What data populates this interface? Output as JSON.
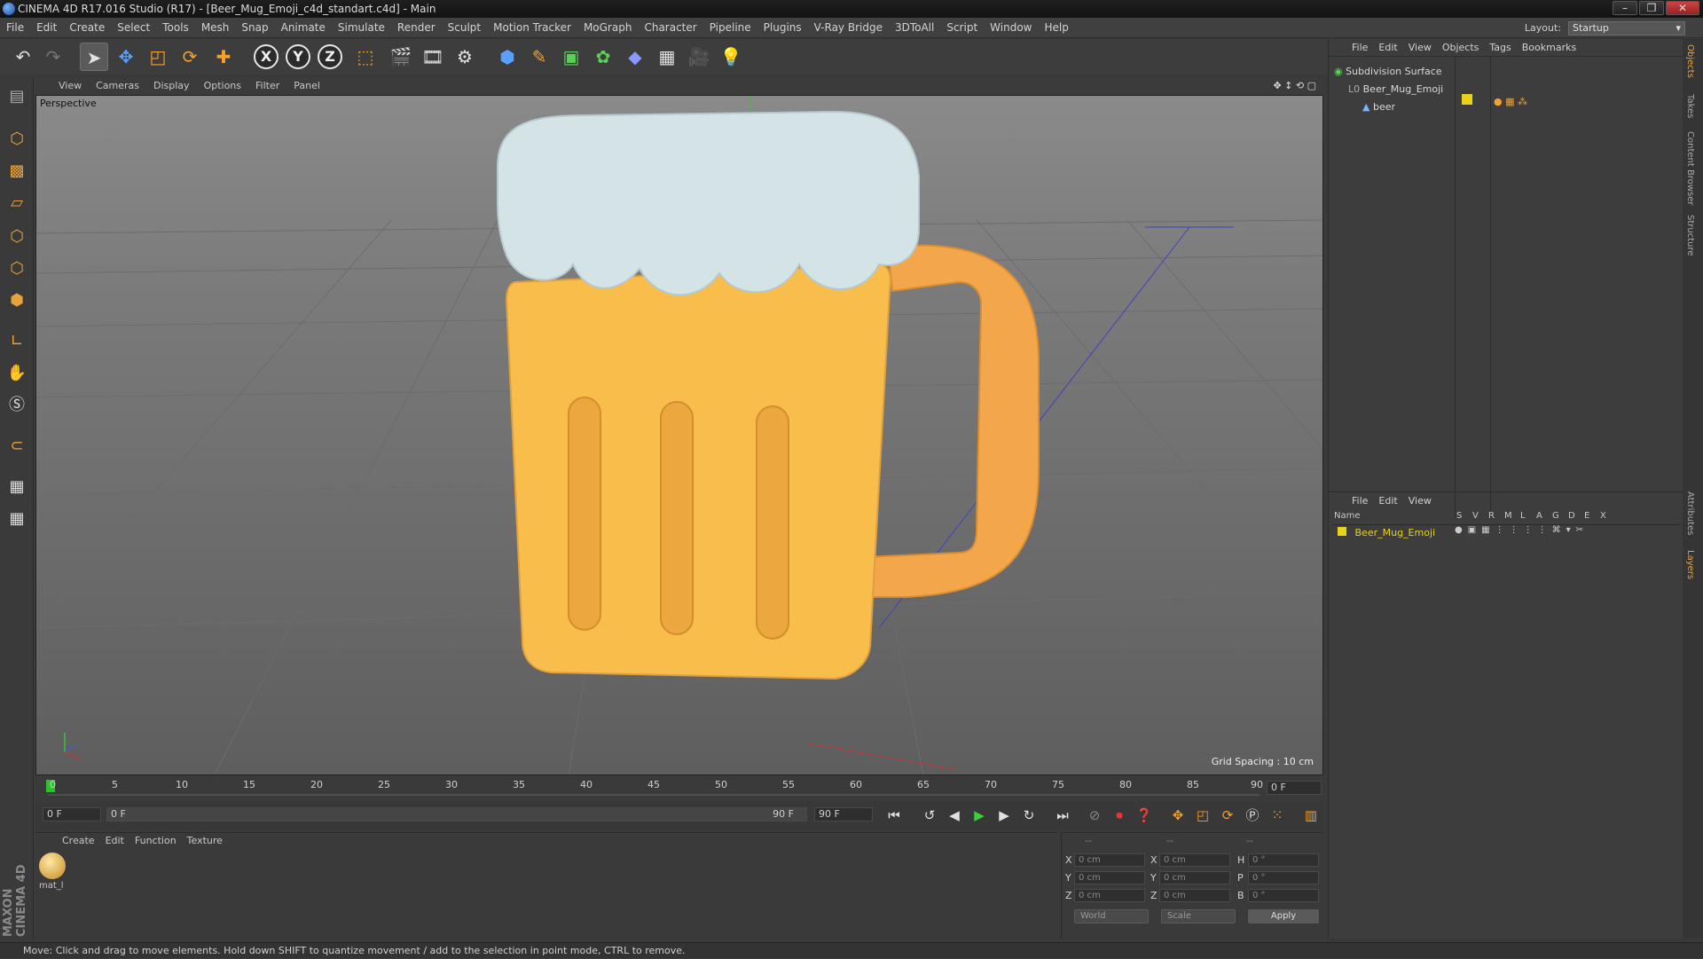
{
  "window": {
    "title": "CINEMA 4D R17.016 Studio (R17) - [Beer_Mug_Emoji_c4d_standart.c4d] - Main",
    "controls": [
      "–",
      "❐",
      "✕"
    ]
  },
  "menubar": [
    "File",
    "Edit",
    "Create",
    "Select",
    "Tools",
    "Mesh",
    "Snap",
    "Animate",
    "Simulate",
    "Render",
    "Sculpt",
    "Motion Tracker",
    "MoGraph",
    "Character",
    "Pipeline",
    "Plugins",
    "V-Ray Bridge",
    "3DToAll",
    "Script",
    "Window",
    "Help"
  ],
  "layout": {
    "label": "Layout:",
    "value": "Startup"
  },
  "toolbar": {
    "axis_x": "X",
    "axis_y": "Y",
    "axis_z": "Z"
  },
  "viewport": {
    "menu": [
      "View",
      "Cameras",
      "Display",
      "Options",
      "Filter",
      "Panel"
    ],
    "label": "Perspective",
    "grid_spacing": "Grid Spacing : 10 cm"
  },
  "timeline": {
    "ticks": [
      "0",
      "5",
      "10",
      "15",
      "20",
      "25",
      "30",
      "35",
      "40",
      "45",
      "50",
      "55",
      "60",
      "65",
      "70",
      "75",
      "80",
      "85",
      "90"
    ],
    "current_frame": "0 F",
    "start": "0 F",
    "range_start": "0 F",
    "range_end": "90 F",
    "end": "90 F"
  },
  "materials": {
    "menu": [
      "Create",
      "Edit",
      "Function",
      "Texture"
    ],
    "items": [
      {
        "label": "mat_l"
      }
    ]
  },
  "coordinates": {
    "header": [
      "--",
      "--",
      "--"
    ],
    "rows": [
      {
        "l1": "X",
        "v1": "0 cm",
        "l2": "X",
        "v2": "0 cm",
        "l3": "H",
        "v3": "0 °"
      },
      {
        "l1": "Y",
        "v1": "0 cm",
        "l2": "Y",
        "v2": "0 cm",
        "l3": "P",
        "v3": "0 °"
      },
      {
        "l1": "Z",
        "v1": "0 cm",
        "l2": "Z",
        "v2": "0 cm",
        "l3": "B",
        "v3": "0 °"
      }
    ],
    "mode": "World",
    "transform": "Scale",
    "apply": "Apply"
  },
  "objects_panel": {
    "menu": [
      "File",
      "Edit",
      "View",
      "Objects",
      "Tags",
      "Bookmarks"
    ],
    "items": [
      {
        "name": "Subdivision Surface"
      },
      {
        "name": "Beer_Mug_Emoji"
      },
      {
        "name": "beer"
      }
    ]
  },
  "layers_panel": {
    "menu": [
      "File",
      "Edit",
      "View"
    ],
    "columns": [
      "Name",
      "S",
      "V",
      "R",
      "M",
      "L",
      "A",
      "G",
      "D",
      "E",
      "X"
    ],
    "items": [
      {
        "name": "Beer_Mug_Emoji",
        "color": "#e8d21a"
      }
    ]
  },
  "right_tabs": [
    "Objects",
    "Takes",
    "Content Browser",
    "Structure",
    "Attributes",
    "Layers"
  ],
  "brand": "MAXON CINEMA 4D",
  "status": "Move: Click and drag to move elements. Hold down SHIFT to quantize movement / add to the selection in point mode, CTRL to remove.",
  "colors": {
    "mug": "#f9bd4c",
    "handle": "#f3a64a",
    "foam": "#d3e3e6",
    "accent": "#e8a23a"
  }
}
